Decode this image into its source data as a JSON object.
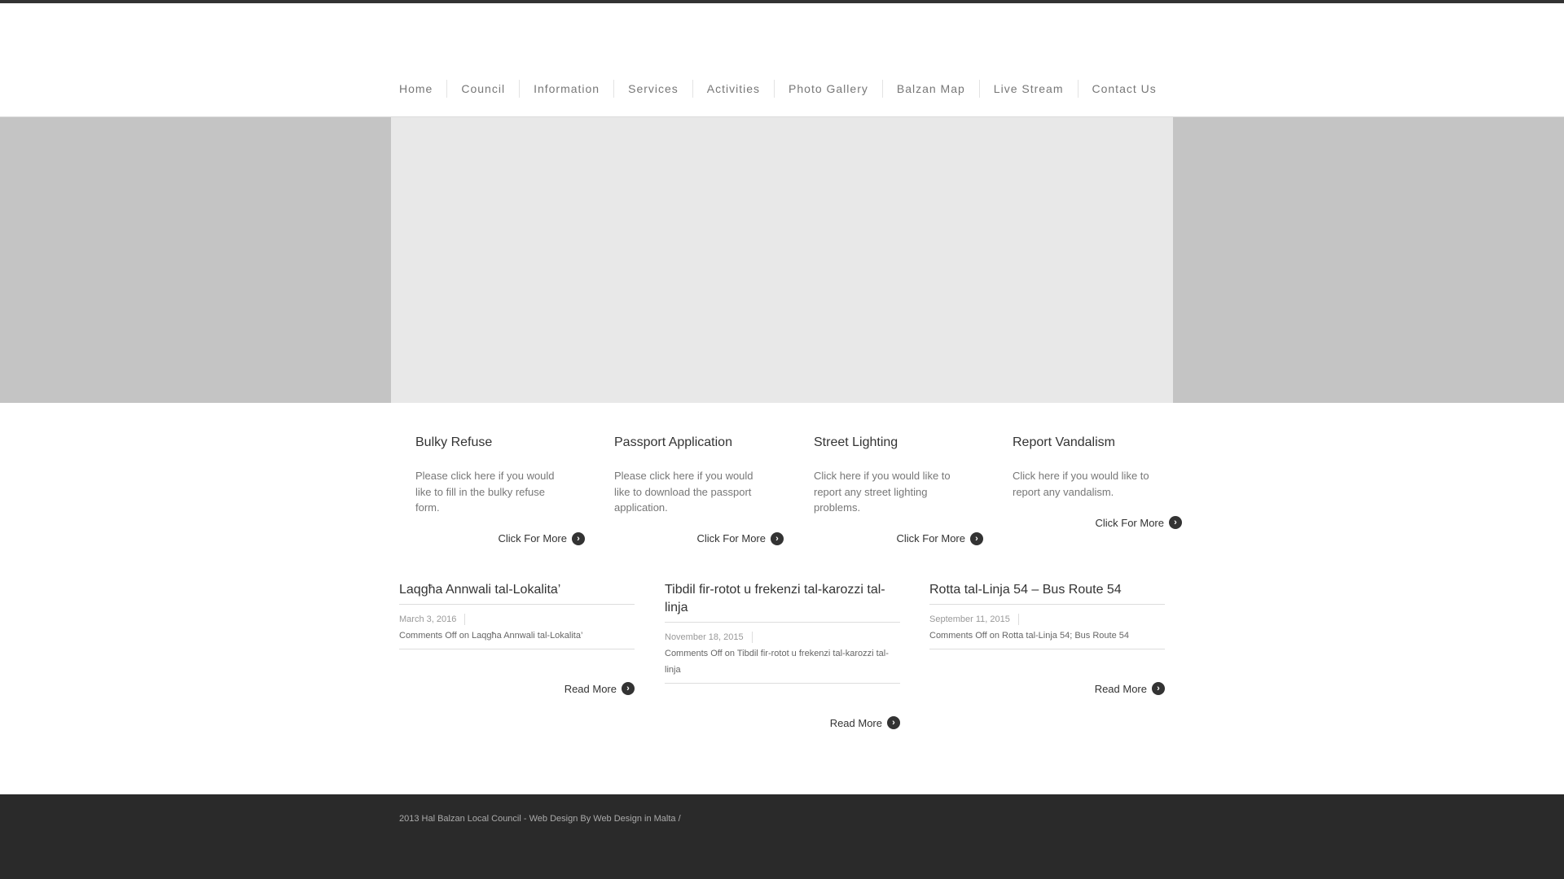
{
  "nav": [
    "Home",
    "Council",
    "Information",
    "Services",
    "Activities",
    "Photo Gallery",
    "Balzan Map",
    "Live Stream",
    "Contact Us"
  ],
  "services": [
    {
      "title": "Bulky Refuse",
      "text": "Please click here if you would like to fill in the bulky refuse form.",
      "link": "Click For More"
    },
    {
      "title": "Passport Application",
      "text": "Please click here if you would like to download the passport application.",
      "link": "Click For More"
    },
    {
      "title": "Street Lighting",
      "text": "Click here if you would like to report any street lighting problems.",
      "link": "Click For More"
    },
    {
      "title": "Report Vandalism",
      "text": "Click here if you would like to report any vandalism.",
      "link": "Click For More"
    }
  ],
  "posts": [
    {
      "title": "Laqgħa Annwali tal-Lokalita’",
      "date": "March 3, 2016",
      "comments": "Comments Off on Laqgħa Annwali tal-Lokalita’",
      "link": "Read More"
    },
    {
      "title": "Tibdil fir-rotot u frekenzi tal-karozzi tal-linja",
      "date": "November 18, 2015",
      "comments": "Comments Off on Tibdil fir-rotot u frekenzi tal-karozzi tal-linja",
      "link": "Read More"
    },
    {
      "title": "Rotta tal-Linja 54 – Bus Route 54",
      "date": "September 11, 2015",
      "comments": "Comments Off on Rotta tal-Linja 54; Bus Route 54",
      "link": "Read More"
    }
  ],
  "footer": "2013 Hal Balzan Local Council - Web Design By Web Design in Malta /"
}
